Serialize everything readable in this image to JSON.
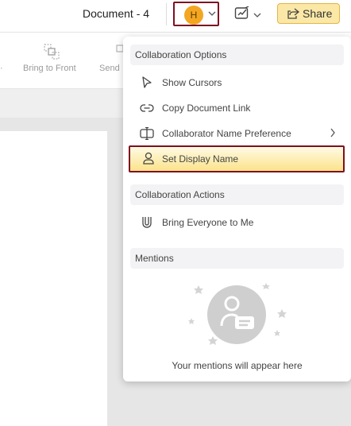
{
  "header": {
    "doc_title": "Document - 4",
    "avatar_initial": "H",
    "share_label": "Share",
    "colors": {
      "accent_border": "#7d1020",
      "share_bg": "#fbe8a6",
      "avatar_bg": "#f3a622"
    }
  },
  "toolbar": {
    "bring_to_front": "Bring to Front",
    "send_partial": "Send"
  },
  "menu": {
    "collab_options_title": "Collaboration Options",
    "options": [
      {
        "label": "Show Cursors",
        "icon": "cursor-icon"
      },
      {
        "label": "Copy Document Link",
        "icon": "link-icon"
      },
      {
        "label": "Collaborator Name Preference",
        "icon": "name-preference-icon"
      },
      {
        "label": "Set Display Name",
        "icon": "user-icon"
      }
    ],
    "collab_actions_title": "Collaboration Actions",
    "actions": [
      {
        "label": "Bring Everyone to Me",
        "icon": "magnet-icon"
      }
    ],
    "mentions_title": "Mentions",
    "mentions_empty": "Your mentions will appear here"
  }
}
